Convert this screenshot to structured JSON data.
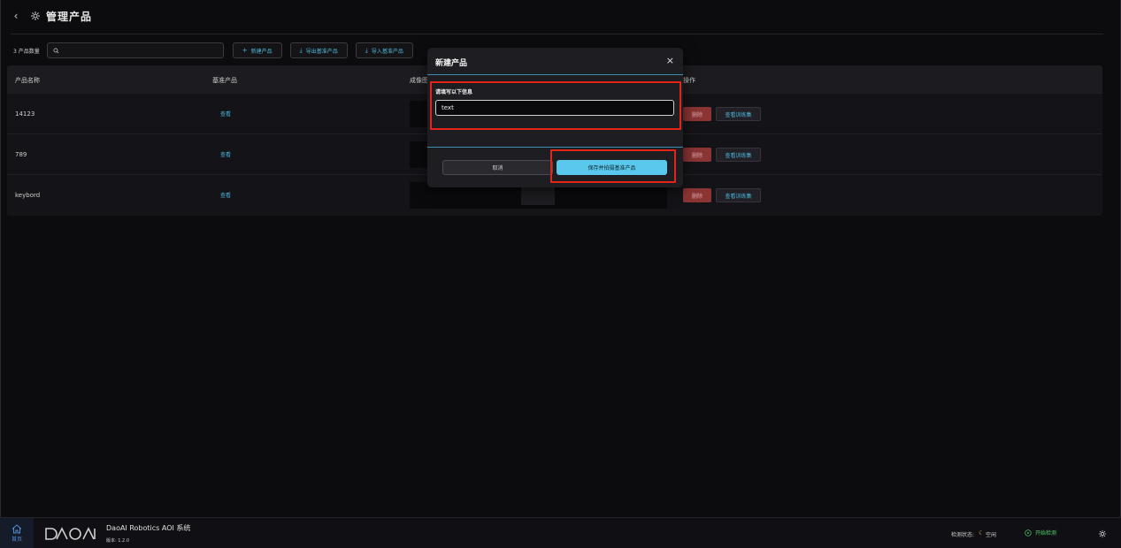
{
  "header": {
    "title": "管理产品"
  },
  "toolbar": {
    "count_label": "3 产品数量",
    "search_placeholder": "",
    "buttons": {
      "new_product": "新建产品",
      "export_base": "导出基准产品",
      "import_base": "导入基准产品"
    }
  },
  "table": {
    "headers": {
      "name": "产品名称",
      "base": "基准产品",
      "image": "成像图",
      "actions": "操作"
    },
    "rows": [
      {
        "name": "14123",
        "view": "查看",
        "delete": "删除",
        "train": "查看训练集"
      },
      {
        "name": "789",
        "view": "查看",
        "delete": "删除",
        "train": "查看训练集"
      },
      {
        "name": "keybord",
        "view": "查看",
        "delete": "删除",
        "train": "查看训练集"
      }
    ]
  },
  "modal": {
    "title": "新建产品",
    "close": "×",
    "prompt": "请填写以下信息",
    "input_value": "text",
    "cancel": "取消",
    "save": "保存并拍摄基准产品"
  },
  "footer": {
    "home_label": "首页",
    "brand_title": "DaoAI Robotics AOI 系统",
    "version": "版本: 1.2.0",
    "status_label": "检测状态:",
    "status_value": "空闲",
    "start_detect": "开始检测"
  },
  "colors": {
    "accent": "#4fb6d8",
    "primary_button": "#5ac8ec",
    "danger": "#8a3434",
    "highlight": "#e2241b",
    "success": "#4fd06a"
  }
}
